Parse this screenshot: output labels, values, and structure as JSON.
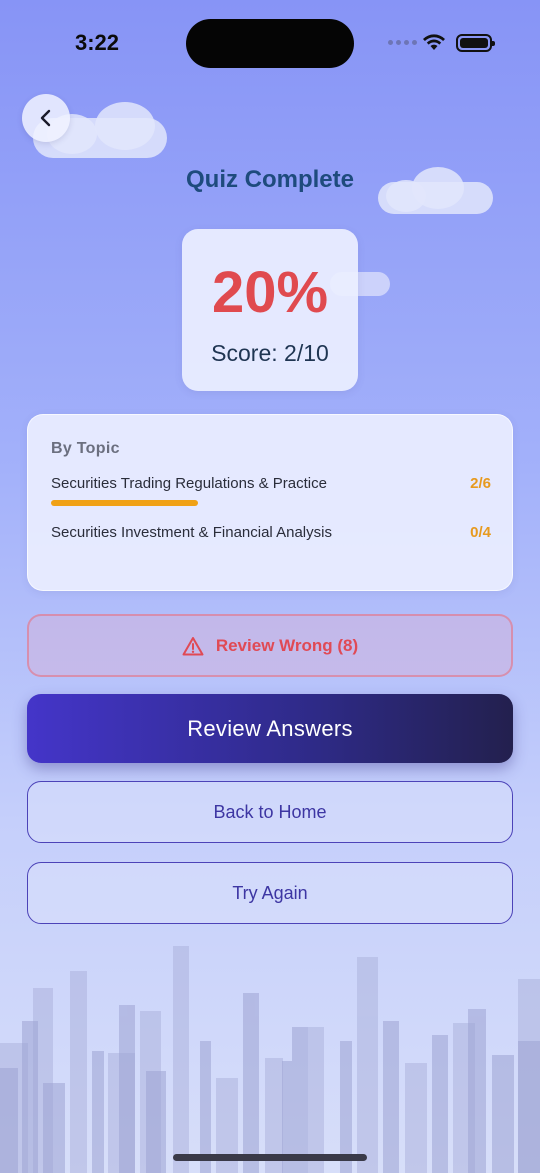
{
  "status_bar": {
    "time": "3:22"
  },
  "header": {
    "title": "Quiz Complete"
  },
  "score": {
    "percent": "20%",
    "label": "Score: 2/10"
  },
  "topics": {
    "heading": "By Topic",
    "items": [
      {
        "name": "Securities Trading Regulations & Practice",
        "score": "2/6",
        "progress": 0.333
      },
      {
        "name": "Securities Investment & Financial Analysis",
        "score": "0/4",
        "progress": 0
      }
    ]
  },
  "actions": {
    "review_wrong": "Review Wrong (8)",
    "review_answers": "Review Answers",
    "back_home": "Back to Home",
    "try_again": "Try Again"
  },
  "icons": {
    "back": "chevron-left-icon",
    "warning": "warning-triangle-icon"
  },
  "colors": {
    "accent": "#4435c9",
    "score": "#e04a4f",
    "topic_score": "#e79a1f",
    "title": "#1e4b7d"
  }
}
